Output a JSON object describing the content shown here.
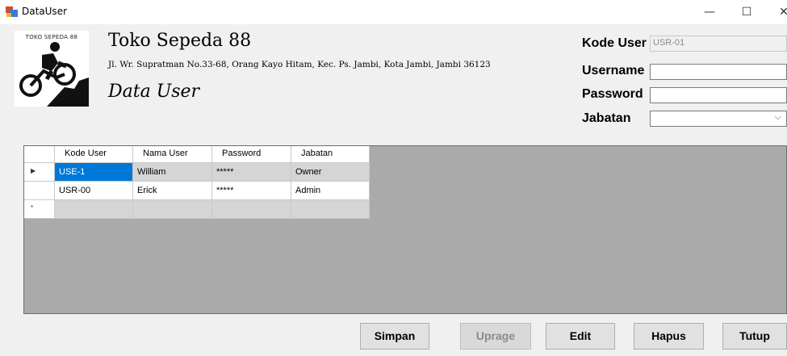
{
  "window": {
    "title": "DataUser",
    "controls": {
      "minimize": "—",
      "maximize": "☐",
      "close": "✕"
    }
  },
  "header": {
    "logo_text": "TOKO SEPEDA 88",
    "store_name": "Toko Sepeda 88",
    "address": "Jl. Wr. Supratman No.33-68, Orang Kayo Hitam, Kec. Ps. Jambi, Kota Jambi, Jambi 36123",
    "form_title": "Data User"
  },
  "form": {
    "kode_user_label": "Kode User",
    "kode_user_value": "USR-01",
    "username_label": "Username",
    "username_value": "",
    "password_label": "Password",
    "password_value": "",
    "jabatan_label": "Jabatan",
    "jabatan_value": "",
    "dropdown_arrow": "⌵"
  },
  "grid": {
    "columns": [
      "Kode User",
      "Nama User",
      "Password",
      "Jabatan"
    ],
    "current_row_marker": "▶",
    "new_row_marker": "*",
    "rows": [
      [
        "USE-1",
        "William",
        "*****",
        "Owner"
      ],
      [
        "USR-00",
        "Erick",
        "*****",
        "Admin"
      ]
    ]
  },
  "buttons": {
    "simpan": "Simpan",
    "upgrade": "Uprage",
    "edit": "Edit",
    "hapus": "Hapus",
    "tutup": "Tutup"
  },
  "colors": {
    "selection": "#0078d7",
    "grid_background": "#aaaaaa",
    "window_background": "#f0f0f0"
  }
}
